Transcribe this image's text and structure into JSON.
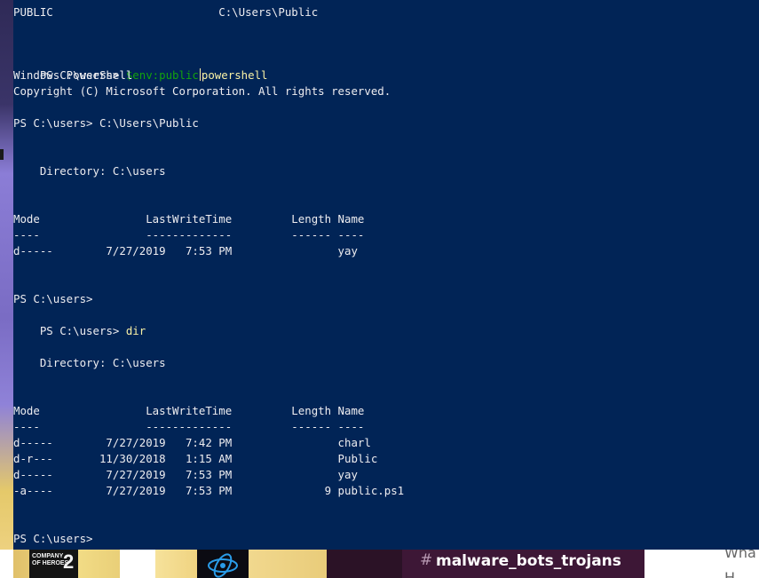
{
  "console": {
    "line_top_partial": "PUBLIC                         C:\\Users\\Public",
    "prompt_1": "PS C:\\users> ",
    "cmd_1_part_a": "$env:public",
    "cmd_1_part_b": "powershell",
    "banner_1": "Windows PowerShell",
    "banner_2": "Copyright (C) Microsoft Corporation. All rights reserved.",
    "prompt_2": "PS C:\\users> C:\\Users\\Public",
    "dir_header_1": "    Directory: C:\\users",
    "col_header_1": "Mode                LastWriteTime         Length Name",
    "col_rule_1": "----                -------------         ------ ----",
    "listing_1": [
      "d-----        7/27/2019   7:53 PM                yay"
    ],
    "prompt_3": "PS C:\\users>",
    "prompt_4": "PS C:\\users> ",
    "cmd_4": "dir",
    "dir_header_2": "    Directory: C:\\users",
    "col_header_2": "Mode                LastWriteTime         Length Name",
    "col_rule_2": "----                -------------         ------ ----",
    "listing_2": [
      "d-----        7/27/2019   7:42 PM                charl",
      "d-r---       11/30/2018   1:15 AM                Public",
      "d-----        7/27/2019   7:53 PM                yay",
      "-a----        7/27/2019   7:53 PM              9 public.ps1"
    ],
    "prompt_5": "PS C:\\users>"
  },
  "background": {
    "game_tile_text": "COMPANY\nOF HEROES",
    "game_tile_number": "2",
    "channel_hash": "#",
    "channel_name": "malware_bots_trojans",
    "page_fragment_1": "Wha",
    "page_fragment_2": "H"
  },
  "colors": {
    "console_bg": "#012456",
    "console_fg": "#eeedf0",
    "command_green": "#13a10e",
    "command_yellow": "#f9f1a5",
    "channel_banner_bg": "#3d1736"
  },
  "icons": {
    "battlenet": "battlenet-logo-icon"
  }
}
